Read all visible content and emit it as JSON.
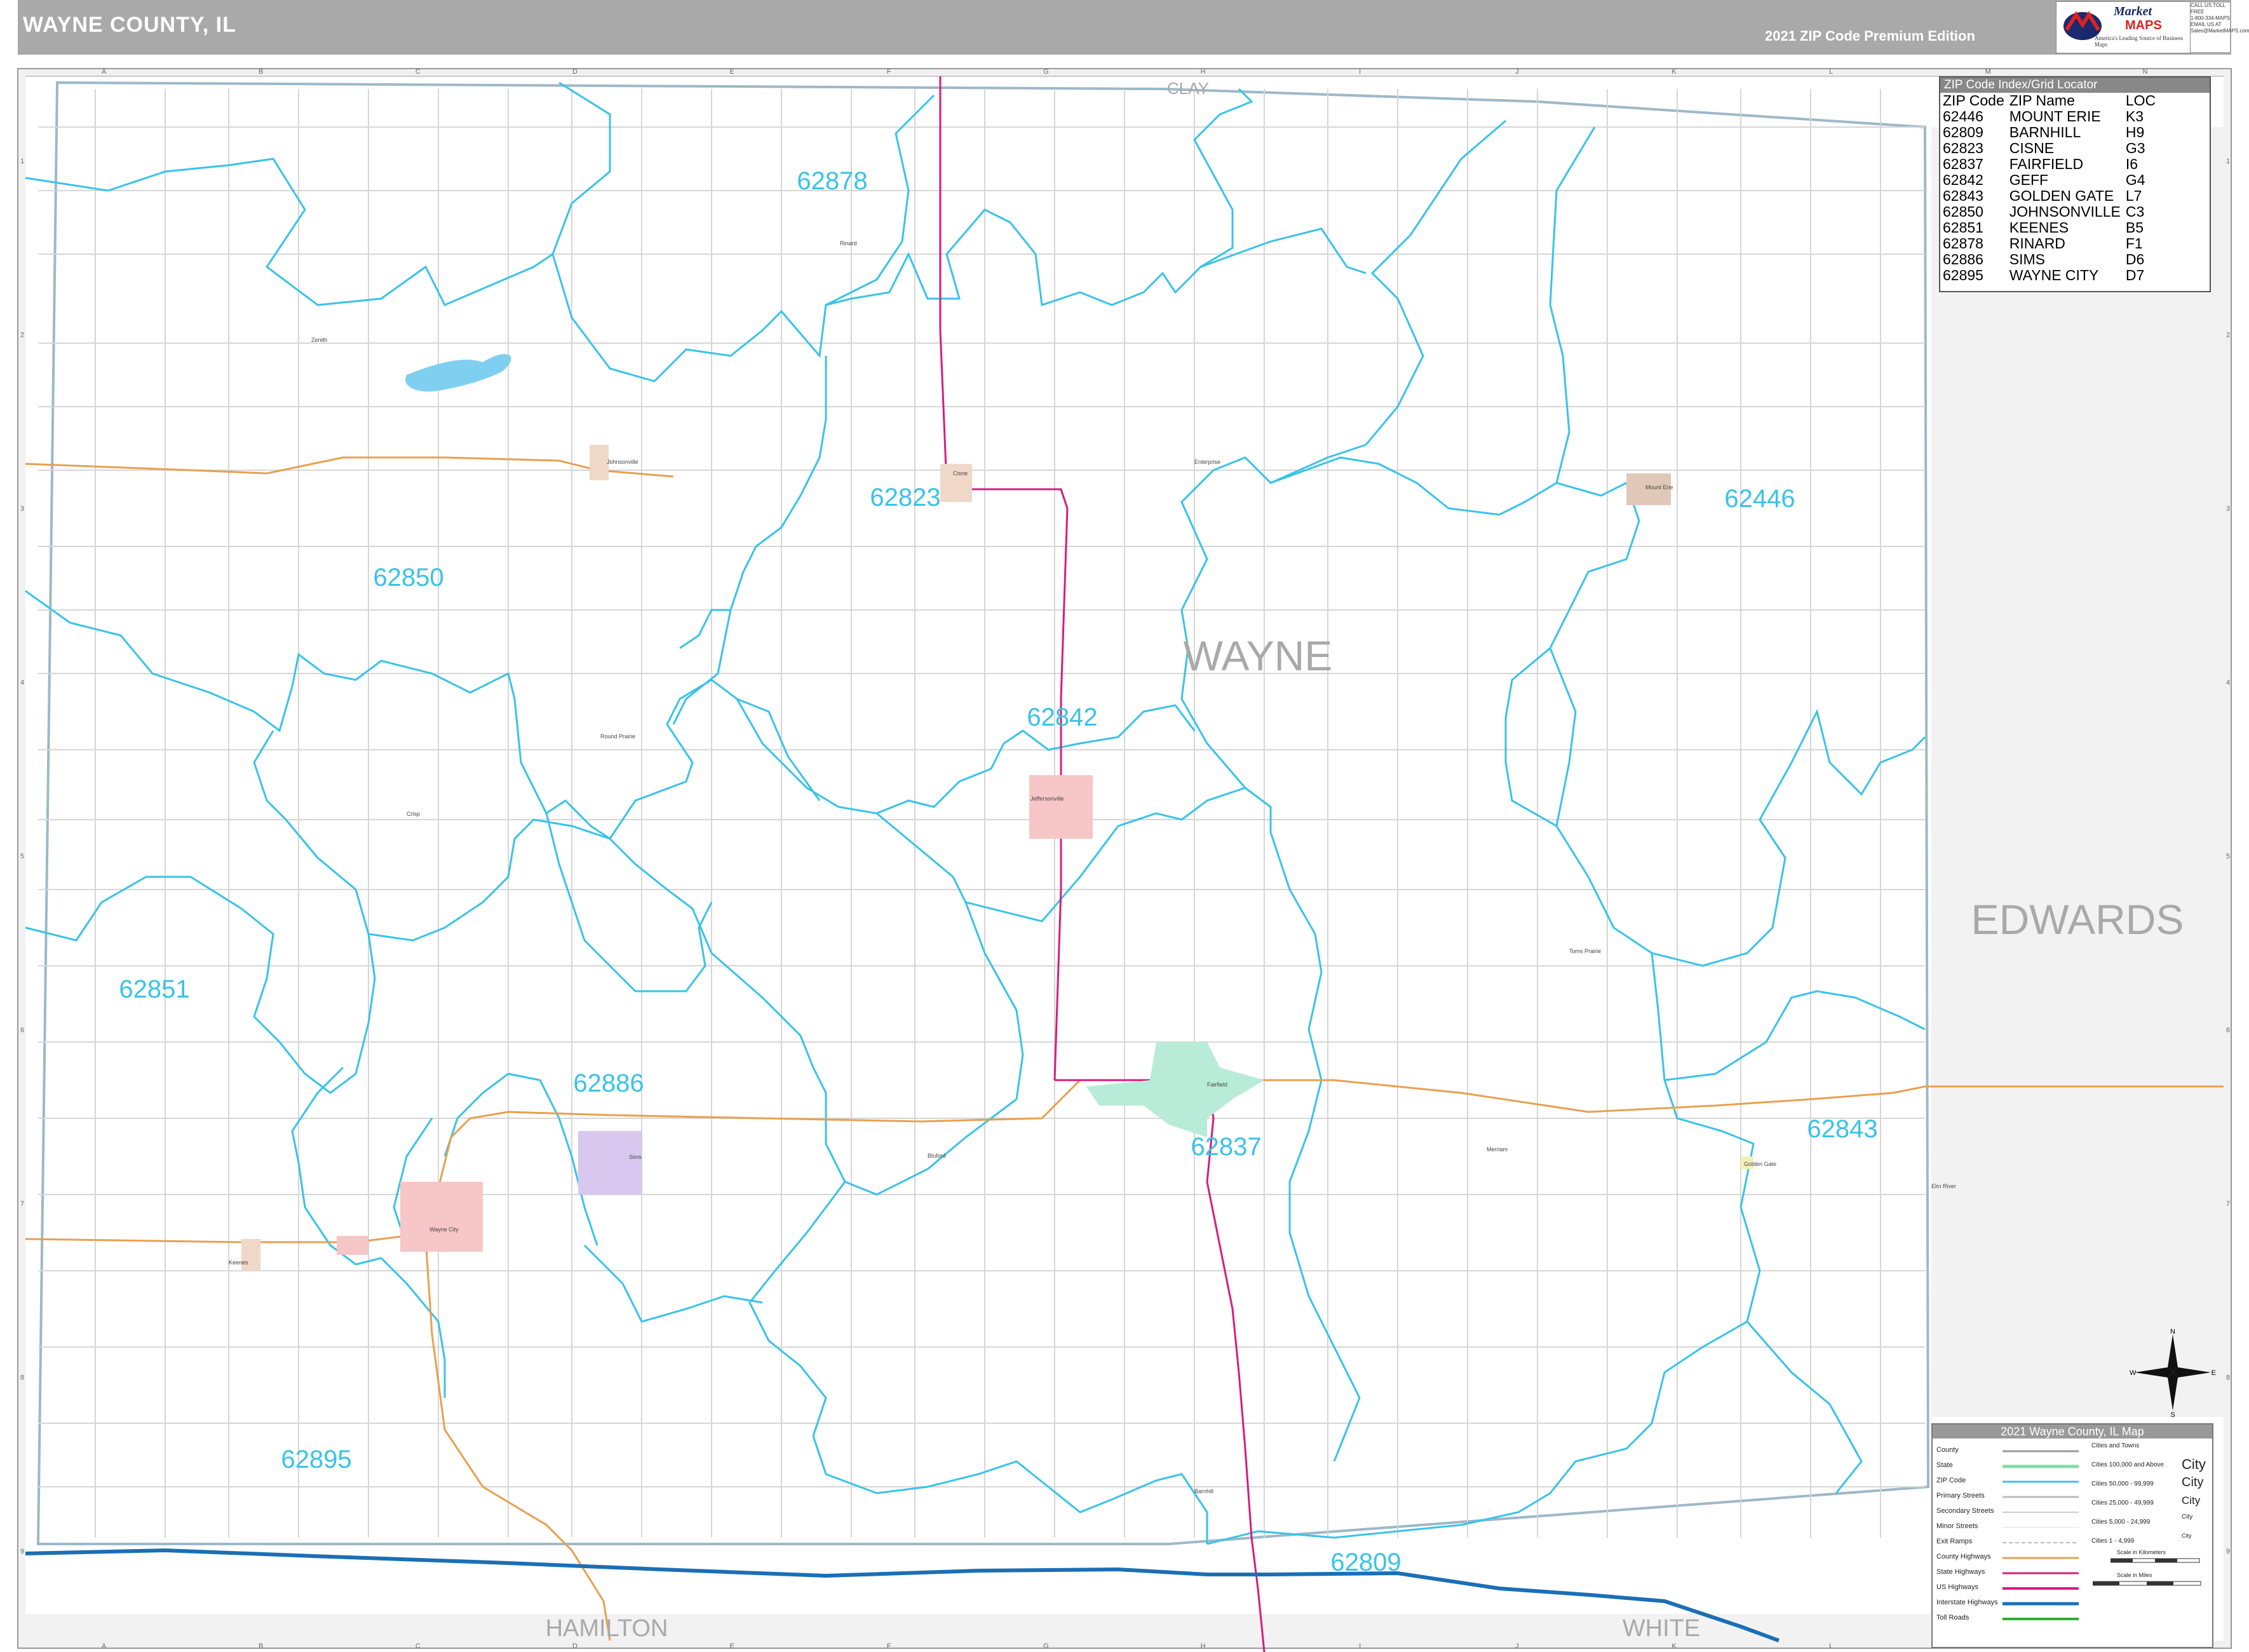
{
  "header": {
    "title": "WAYNE COUNTY, IL",
    "edition": "2021 ZIP Code Premium Edition",
    "logo_brand_1": "Market",
    "logo_brand_2": "MAPS",
    "logo_tag": "America's Leading Source of Business Maps",
    "phone_lines": [
      "CALL US TOLL FREE",
      "1-800-334-MAPS",
      "EMAIL US AT",
      "Sales@MarketMAPS.com"
    ]
  },
  "grid": {
    "columns": [
      "A",
      "B",
      "C",
      "D",
      "E",
      "F",
      "G",
      "H",
      "I",
      "J",
      "K",
      "L",
      "M",
      "N"
    ],
    "rows": [
      "1",
      "2",
      "3",
      "4",
      "5",
      "6",
      "7",
      "8",
      "9"
    ]
  },
  "map": {
    "county_name": "WAYNE",
    "neighbors": {
      "north": "CLAY",
      "east": "EDWARDS",
      "south_west": "HAMILTON",
      "south_east": "WHITE"
    },
    "zip_labels": [
      {
        "zip": "62878"
      },
      {
        "zip": "62823"
      },
      {
        "zip": "62446"
      },
      {
        "zip": "62850"
      },
      {
        "zip": "62842"
      },
      {
        "zip": "62851"
      },
      {
        "zip": "62886"
      },
      {
        "zip": "62837"
      },
      {
        "zip": "62843"
      },
      {
        "zip": "62895"
      },
      {
        "zip": "62809"
      }
    ],
    "towns": [
      "Rinard",
      "Zenith",
      "Johnsonville",
      "Cisne",
      "Enterprise",
      "Mount Erie",
      "Round Prairie",
      "Jeffersonville",
      "Crisp",
      "Fairfield",
      "Sims",
      "Wayne City",
      "Keenes",
      "Golden Gate",
      "Merriam",
      "Barnhill",
      "Toms Prairie",
      "Bluford",
      "Elm River"
    ],
    "colors": {
      "zip_boundary": "#38c3e8",
      "state_highway": "#d81b7d",
      "county_highway": "#e8a050",
      "interstate": "#1a6fb5",
      "road": "#cfcfcf",
      "water": "#7fd0f0"
    }
  },
  "zip_index": {
    "title": "ZIP Code Index/Grid Locator",
    "headers": [
      "ZIP Code",
      "ZIP Name",
      "LOC"
    ],
    "rows": [
      [
        "62446",
        "MOUNT ERIE",
        "K3"
      ],
      [
        "62809",
        "BARNHILL",
        "H9"
      ],
      [
        "62823",
        "CISNE",
        "G3"
      ],
      [
        "62837",
        "FAIRFIELD",
        "I6"
      ],
      [
        "62842",
        "GEFF",
        "G4"
      ],
      [
        "62843",
        "GOLDEN GATE",
        "L7"
      ],
      [
        "62850",
        "JOHNSONVILLE",
        "C3"
      ],
      [
        "62851",
        "KEENES",
        "B5"
      ],
      [
        "62878",
        "RINARD",
        "F1"
      ],
      [
        "62886",
        "SIMS",
        "D6"
      ],
      [
        "62895",
        "WAYNE CITY",
        "D7"
      ]
    ]
  },
  "legend": {
    "title": "2021 Wayne County, IL Map",
    "items": [
      "County",
      "State",
      "ZIP Code",
      "Primary Streets",
      "Secondary Streets",
      "Minor Streets",
      "Exit Ramps",
      "County Highways",
      "State Highways",
      "US Highways",
      "Interstate Highways",
      "Toll Roads"
    ],
    "city_sizes": [
      {
        "label": "Cities and Towns",
        "sample": ""
      },
      {
        "label": "Cities 100,000 and Above",
        "sample": "City"
      },
      {
        "label": "Cities 50,000 - 99,999",
        "sample": "City"
      },
      {
        "label": "Cities 25,000 - 49,999",
        "sample": "City"
      },
      {
        "label": "Cities 5,000 - 24,999",
        "sample": "City"
      },
      {
        "label": "Cities 1 - 4,999",
        "sample": "City"
      }
    ],
    "scale_km": "Scale in Kilometers",
    "scale_mi": "Scale in Miles"
  },
  "compass": {
    "n": "N",
    "e": "E",
    "s": "S",
    "w": "W"
  }
}
